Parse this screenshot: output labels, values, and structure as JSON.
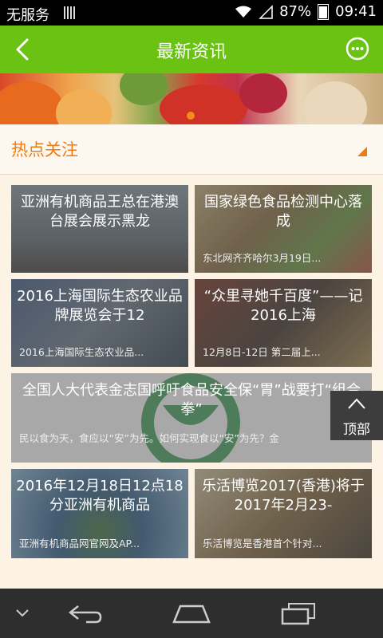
{
  "status_bar": {
    "carrier": "无服务",
    "battery": "87%",
    "time": "09:41",
    "icons": [
      "signal-bars-icon",
      "wifi-icon",
      "cell-signal-icon",
      "battery-charging-icon"
    ]
  },
  "header": {
    "title": "最新资讯",
    "back_icon": "chevron-left-icon",
    "message_icon": "chat-bubble-icon"
  },
  "banner": {
    "page_count": 1,
    "active_index": 0
  },
  "section": {
    "title": "热点关注",
    "accent_color": "#f07a12"
  },
  "news": [
    {
      "title": "亚洲有机商品王总在港澳台展会展示黑龙",
      "summary": ""
    },
    {
      "title": "国家绿色食品检测中心落成",
      "summary": "东北网齐齐哈尔3月19日..."
    },
    {
      "title": "2016上海国际生态农业品牌展览会于12",
      "summary": "2016上海国际生态农业品..."
    },
    {
      "title": "“众里寻她千百度”——记2016上海",
      "summary": "12月8日-12日 第二届上..."
    },
    {
      "title": "全国人大代表金志国呼吁食品安全保“胃”战要打“组合拳”",
      "summary": "民以食为天，食应以“安”为先。如何实现食以“安”为先？金"
    },
    {
      "title": "2016年12月18日12点18分亚洲有机商品",
      "summary": "亚洲有机商品网官网及AP..."
    },
    {
      "title": "乐活博览2017(香港)将于2017年2月23-",
      "summary": "乐活博览是香港首个针对..."
    }
  ],
  "back_to_top": {
    "label": "顶部",
    "icon": "chevron-up-icon"
  },
  "nav_bar": {
    "icons": [
      "hide-keyboard-icon",
      "back-icon",
      "home-icon",
      "recent-apps-icon"
    ]
  },
  "colors": {
    "brand_green": "#6ac312",
    "background": "#fdf3e4",
    "accent": "#f07a12"
  }
}
